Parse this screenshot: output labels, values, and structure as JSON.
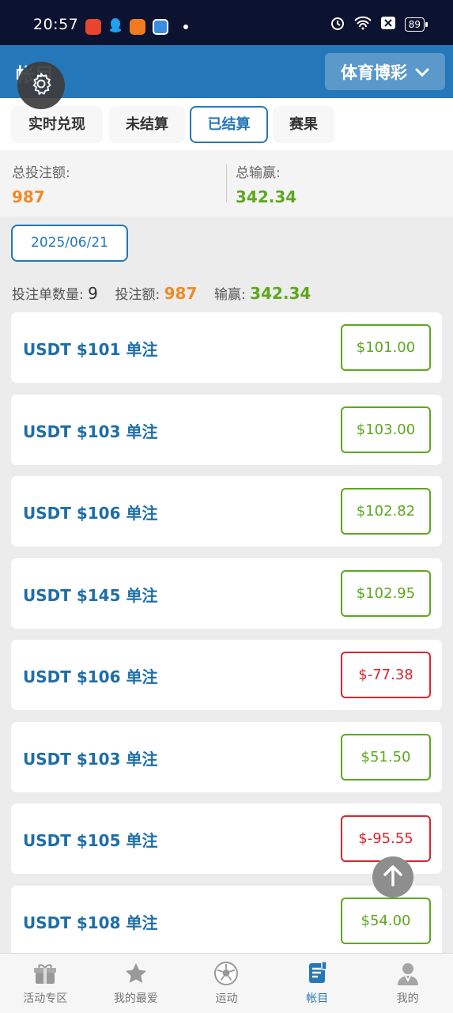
{
  "status_bar": {
    "time": "20:57",
    "battery": "89"
  },
  "header": {
    "title": "帐目",
    "category": "体育博彩"
  },
  "tabs": [
    {
      "label": "实时兑现"
    },
    {
      "label": "未结算"
    },
    {
      "label": "已结算",
      "active": true
    },
    {
      "label": "赛果"
    }
  ],
  "summary": {
    "total_bet_label": "总投注额:",
    "total_bet_value": "987",
    "total_winloss_label": "总输赢:",
    "total_winloss_value": "342.34"
  },
  "date_filter": "2025/06/21",
  "stats": {
    "count_label": "投注单数量:",
    "count_value": "9",
    "bet_label": "投注额:",
    "bet_value": "987",
    "winloss_label": "输赢:",
    "winloss_value": "342.34"
  },
  "bets": [
    {
      "title": "USDT $101 单注",
      "result": "$101.00",
      "positive": true
    },
    {
      "title": "USDT $103 单注",
      "result": "$103.00",
      "positive": true
    },
    {
      "title": "USDT $106 单注",
      "result": "$102.82",
      "positive": true
    },
    {
      "title": "USDT $145 单注",
      "result": "$102.95",
      "positive": true
    },
    {
      "title": "USDT $106 单注",
      "result": "$-77.38",
      "positive": false
    },
    {
      "title": "USDT $103 单注",
      "result": "$51.50",
      "positive": true
    },
    {
      "title": "USDT $105 单注",
      "result": "$-95.55",
      "positive": false
    },
    {
      "title": "USDT $108 单注",
      "result": "$54.00",
      "positive": true
    }
  ],
  "bottom_nav": [
    {
      "label": "活动专区",
      "icon": "gift-icon"
    },
    {
      "label": "我的最爱",
      "icon": "star-icon"
    },
    {
      "label": "运动",
      "icon": "soccer-ball-icon"
    },
    {
      "label": "帐目",
      "icon": "ledger-icon",
      "active": true
    },
    {
      "label": "我的",
      "icon": "user-icon"
    }
  ],
  "colors": {
    "primary": "#2477b9",
    "positive": "#5ca81e",
    "negative": "#d8262e",
    "amount": "#f08a2a"
  }
}
